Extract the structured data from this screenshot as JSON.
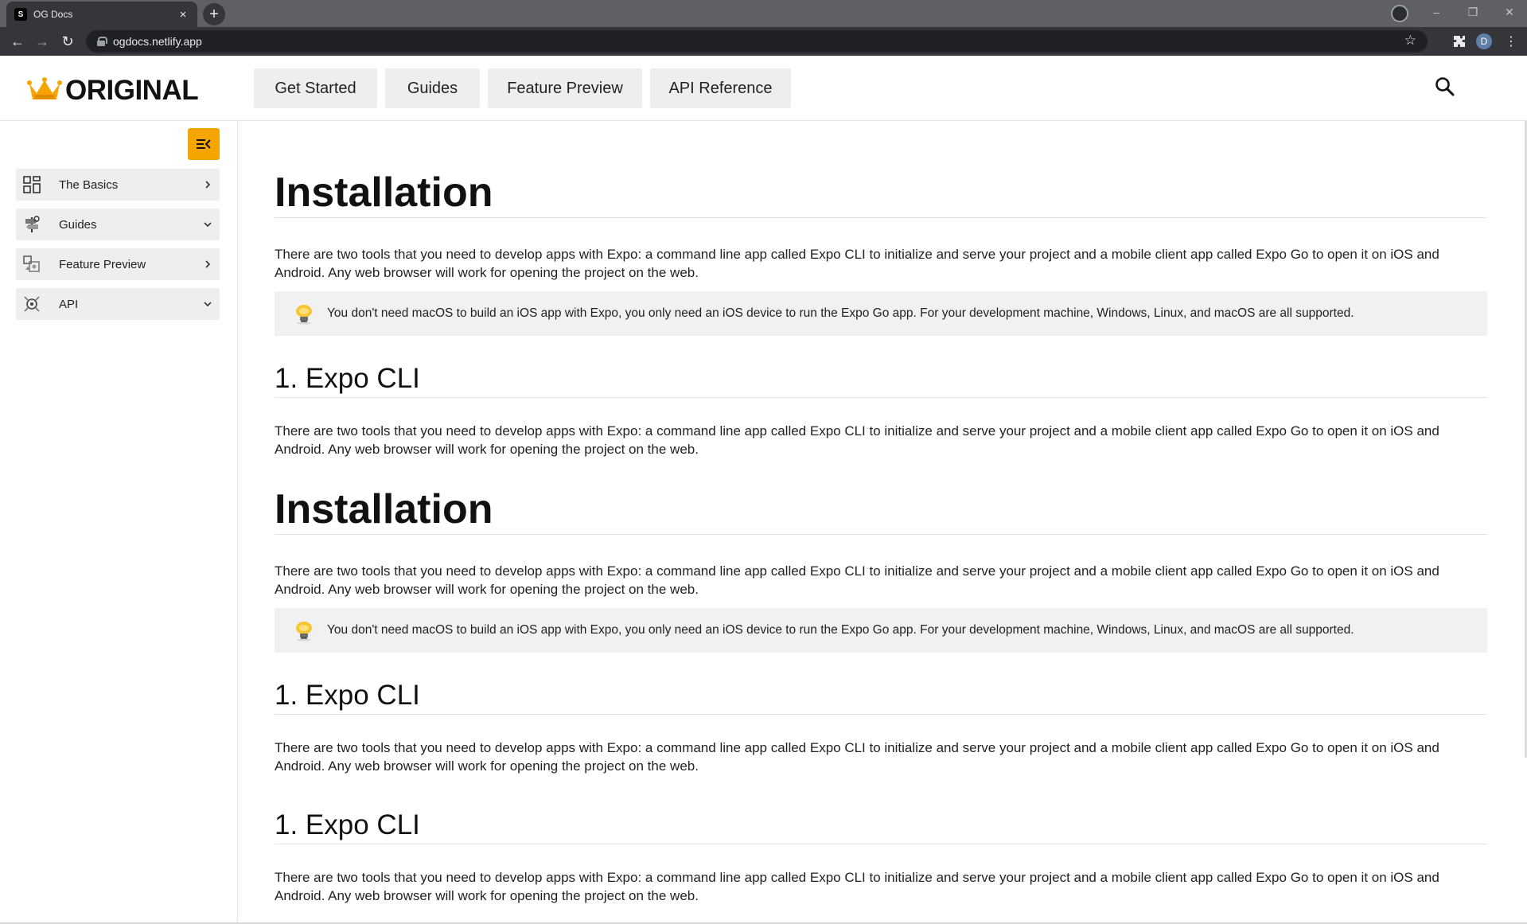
{
  "browser": {
    "tab_title": "OG Docs",
    "tab_favicon": "S",
    "tab_close": "×",
    "new_tab": "+",
    "url": "ogdocs.netlify.app",
    "profile_initial": "D",
    "window_minimize": "–",
    "window_restore": "❐",
    "window_close": "✕",
    "back": "←",
    "forward": "→",
    "reload": "↻",
    "star": "☆",
    "menu": "⋮"
  },
  "header": {
    "logo_text": "ORIGINAL",
    "nav": [
      {
        "label": "Get Started"
      },
      {
        "label": "Guides"
      },
      {
        "label": "Feature Preview"
      },
      {
        "label": "API Reference"
      }
    ]
  },
  "sidebar": {
    "items": [
      {
        "label": "The Basics",
        "icon": "grid-icon",
        "state": "collapsed"
      },
      {
        "label": "Guides",
        "icon": "signpost-icon",
        "state": "expanded"
      },
      {
        "label": "Feature Preview",
        "icon": "preview-icon",
        "state": "collapsed"
      },
      {
        "label": "API",
        "icon": "api-icon",
        "state": "expanded"
      }
    ]
  },
  "content": {
    "sections": [
      {
        "heading": "Installation",
        "paragraph": "There are two tools that you need to develop apps with Expo: a command line app called Expo CLI to initialize and serve your project and a mobile client app called Expo Go to open it on iOS and Android. Any web browser will work for opening the project on the web.",
        "tip": "You don't need macOS to build an iOS app with Expo, you only need an iOS device to run the Expo Go app. For your development machine, Windows, Linux, and macOS are all supported."
      },
      {
        "subheading": "1. Expo CLI",
        "paragraph": "There are two tools that you need to develop apps with Expo: a command line app called Expo CLI to initialize and serve your project and a mobile client app called Expo Go to open it on iOS and Android. Any web browser will work for opening the project on the web."
      },
      {
        "heading": "Installation",
        "paragraph": "There are two tools that you need to develop apps with Expo: a command line app called Expo CLI to initialize and serve your project and a mobile client app called Expo Go to open it on iOS and Android. Any web browser will work for opening the project on the web.",
        "tip": "You don't need macOS to build an iOS app with Expo, you only need an iOS device to run the Expo Go app. For your development machine, Windows, Linux, and macOS are all supported."
      },
      {
        "subheading": "1. Expo CLI",
        "paragraph": "There are two tools that you need to develop apps with Expo: a command line app called Expo CLI to initialize and serve your project and a mobile client app called Expo Go to open it on iOS and Android. Any web browser will work for opening the project on the web."
      },
      {
        "subheading": "1. Expo CLI",
        "paragraph": "There are two tools that you need to develop apps with Expo: a command line app called Expo CLI to initialize and serve your project and a mobile client app called Expo Go to open it on iOS and Android. Any web browser will work for opening the project on the web."
      }
    ]
  },
  "colors": {
    "accent": "#f5a400",
    "chrome_dark": "#35363a",
    "chrome_tabstrip": "#5f6063",
    "nav_button_bg": "#eeeeee",
    "tip_bg": "#f1f1f1"
  }
}
